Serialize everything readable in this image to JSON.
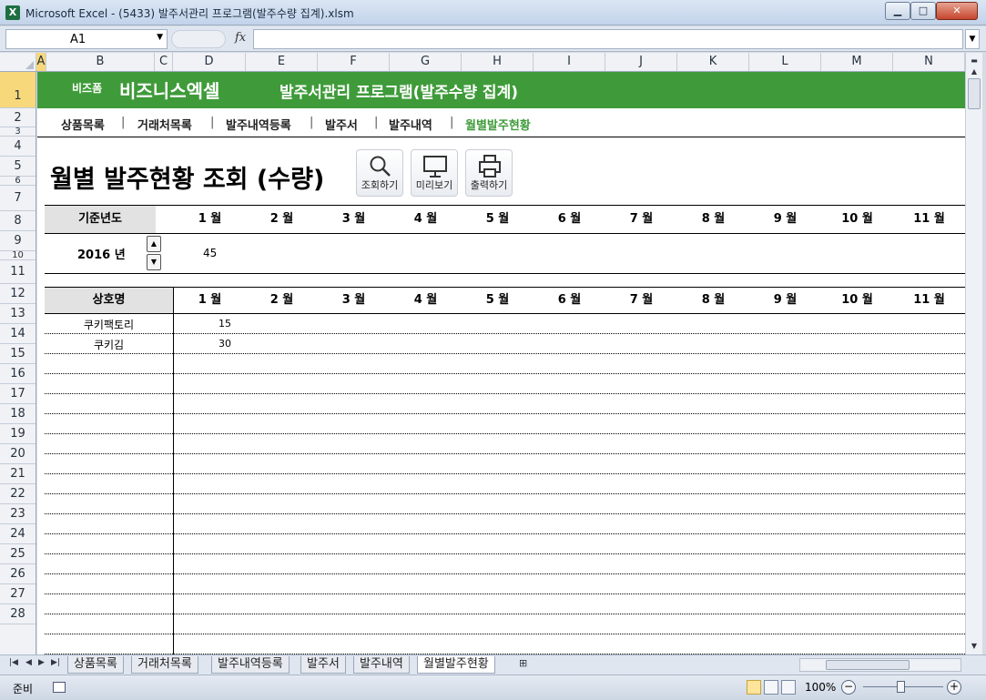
{
  "window": {
    "title": "Microsoft Excel - (5433) 발주서관리 프로그램(발주수량 집계).xlsm",
    "app_icon": "excel-icon",
    "minimize": "▁",
    "maximize": "□",
    "close": "✕"
  },
  "formula_bar": {
    "name_box": "A1",
    "fx": "fx",
    "formula": ""
  },
  "columns": [
    "A",
    "B",
    "C",
    "D",
    "E",
    "F",
    "G",
    "H",
    "I",
    "J",
    "K",
    "L",
    "M",
    "N"
  ],
  "rows": [
    "1",
    "2",
    "3",
    "4",
    "5",
    "6",
    "7",
    "8",
    "9",
    "10",
    "11",
    "12",
    "13",
    "14",
    "15",
    "16",
    "17",
    "18",
    "19",
    "20",
    "21",
    "22",
    "23",
    "24",
    "25",
    "26",
    "27",
    "28"
  ],
  "banner": {
    "brand_small": "비즈폼",
    "brand_big": "비즈니스엑셀",
    "program_title": "발주서관리 프로그램(발주수량 집계)"
  },
  "nav": {
    "items": [
      "상품목록",
      "거래처목록",
      "발주내역등록",
      "발주서",
      "발주내역",
      "월별발주현황"
    ],
    "separator": "|",
    "active_index": 5
  },
  "page": {
    "heading": "월별 발주현황 조회 (수량)"
  },
  "toolbar": {
    "search_label": "조회하기",
    "preview_label": "미리보기",
    "print_label": "출력하기"
  },
  "summary_table": {
    "year_header": "기준년도",
    "year_value": "2016 년",
    "months": [
      "1 월",
      "2 월",
      "3 월",
      "4 월",
      "5 월",
      "6 월",
      "7 월",
      "8 월",
      "9 월",
      "10 월",
      "11 월"
    ],
    "totals": [
      "45",
      "",
      "",
      "",
      "",
      "",
      "",
      "",
      "",
      "",
      ""
    ]
  },
  "detail_table": {
    "company_header": "상호명",
    "months": [
      "1 월",
      "2 월",
      "3 월",
      "4 월",
      "5 월",
      "6 월",
      "7 월",
      "8 월",
      "9 월",
      "10 월",
      "11 월"
    ],
    "rows": [
      {
        "company": "쿠키팩토리",
        "jan": "15"
      },
      {
        "company": "쿠키김",
        "jan": "30"
      }
    ]
  },
  "sheet_tabs": [
    "상품목록",
    "거래처목록",
    "발주내역등록",
    "발주서",
    "발주내역",
    "월별발주현황"
  ],
  "active_sheet_index": 5,
  "status": {
    "ready": "준비",
    "zoom": "100%",
    "zoom_out": "−",
    "zoom_in": "+"
  },
  "colors": {
    "accent_green": "#3f9b3a",
    "header_gray": "#e2e2e2"
  }
}
